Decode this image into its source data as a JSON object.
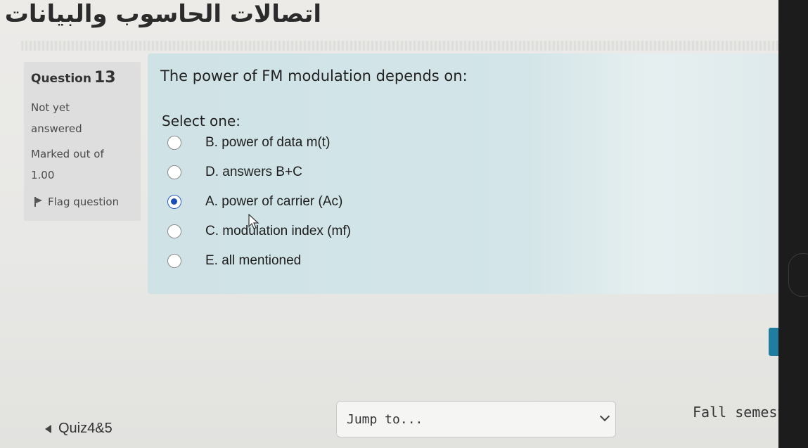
{
  "header": {
    "site_title": "اتصالات الحاسوب والبيانات"
  },
  "question_info": {
    "label": "Question",
    "number": "13",
    "state": "Not yet answered",
    "grade": "Marked out of 1.00",
    "flag_label": "Flag question",
    "flag_icon": "flag-icon"
  },
  "question": {
    "text": "The power of FM modulation depends on:",
    "prompt": "Select one:",
    "options": [
      {
        "label": "B. power of data m(t)",
        "checked": false
      },
      {
        "label": "D. answers B+C",
        "checked": false
      },
      {
        "label": "A. power of carrier (Ac)",
        "checked": true
      },
      {
        "label": "C. modulation index (mf)",
        "checked": false
      },
      {
        "label": "E. all mentioned",
        "checked": false
      }
    ]
  },
  "navigation": {
    "prev_link": "Quiz4&5",
    "jump_placeholder": "Jump to...",
    "next_link": "Fall semeste"
  },
  "colors": {
    "content_bg": "#d3e5e8",
    "selected_radio": "#1a4fb4",
    "side_button": "#1f7ea0"
  }
}
